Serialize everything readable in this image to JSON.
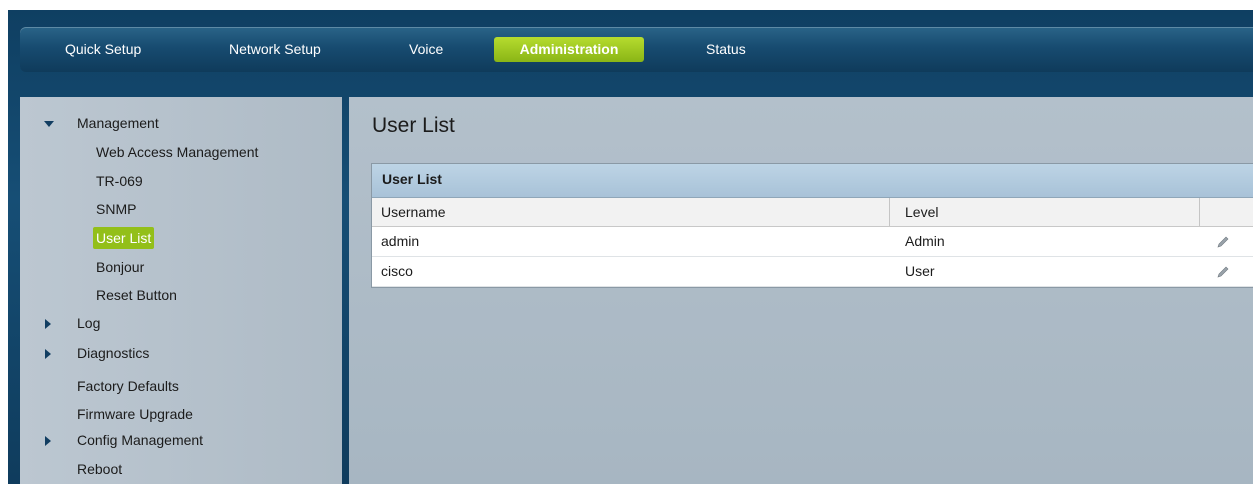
{
  "nav": {
    "tabs": [
      {
        "label": "Quick Setup"
      },
      {
        "label": "Network Setup"
      },
      {
        "label": "Voice"
      },
      {
        "label": "Administration"
      },
      {
        "label": "Status"
      }
    ],
    "active_tab": "Administration"
  },
  "sidebar": {
    "items": [
      {
        "label": "Management",
        "expanded": true
      },
      {
        "label": "Web Access Management"
      },
      {
        "label": "TR-069"
      },
      {
        "label": "SNMP"
      },
      {
        "label": "User List",
        "selected": true
      },
      {
        "label": "Bonjour"
      },
      {
        "label": "Reset Button"
      },
      {
        "label": "Log",
        "expandable": true
      },
      {
        "label": "Diagnostics",
        "expandable": true
      },
      {
        "label": "Factory Defaults"
      },
      {
        "label": "Firmware Upgrade"
      },
      {
        "label": "Config Management",
        "expandable": true
      },
      {
        "label": "Reboot"
      }
    ]
  },
  "main": {
    "title": "User List",
    "table": {
      "caption": "User List",
      "columns": [
        "Username",
        "Level"
      ],
      "rows": [
        {
          "username": "admin",
          "level": "Admin"
        },
        {
          "username": "cisco",
          "level": "User"
        }
      ]
    }
  },
  "colors": {
    "accent": "#93bf19",
    "nav_background": "#164e75",
    "panel_background": "#b3c0cb"
  },
  "icons": {
    "expanded": "down-arrow-icon",
    "collapsed": "right-arrow-icon",
    "edit": "pencil-icon"
  }
}
